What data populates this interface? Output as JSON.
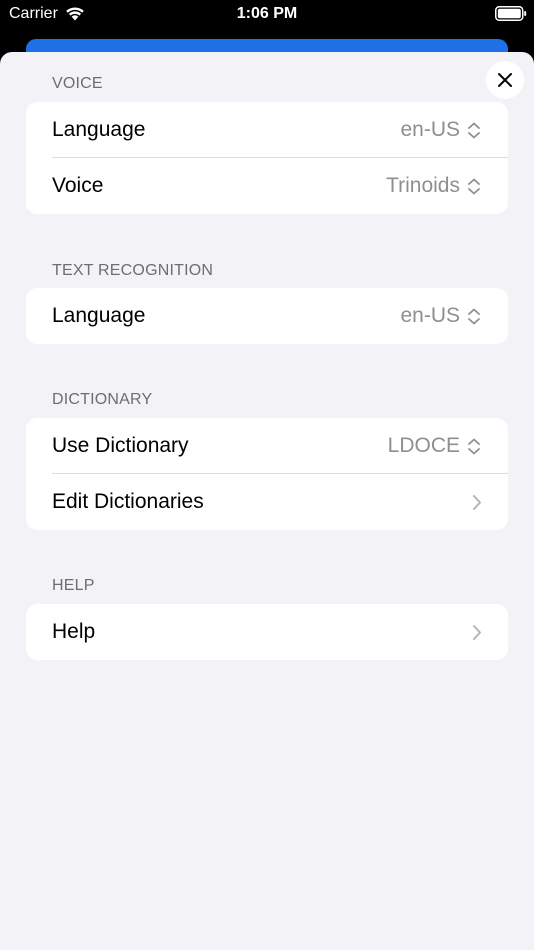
{
  "status_bar": {
    "carrier": "Carrier",
    "time": "1:06 PM"
  },
  "sections": {
    "voice": {
      "header": "VOICE",
      "language_label": "Language",
      "language_value": "en-US",
      "voice_label": "Voice",
      "voice_value": "Trinoids"
    },
    "text_recognition": {
      "header": "TEXT RECOGNITION",
      "language_label": "Language",
      "language_value": "en-US"
    },
    "dictionary": {
      "header": "DICTIONARY",
      "use_label": "Use Dictionary",
      "use_value": "LDOCE",
      "edit_label": "Edit Dictionaries"
    },
    "help": {
      "header": "HELP",
      "help_label": "Help"
    }
  },
  "icons": {
    "close": "close-icon",
    "updown": "chevron-up-down-icon",
    "chevron": "chevron-right-icon",
    "wifi": "wifi-icon",
    "battery": "battery-icon"
  },
  "colors": {
    "background": "#f2f2f7",
    "card": "#ffffff",
    "accent_behind": "#1f6fe6",
    "secondary_text": "#8e8e93",
    "header_text": "#6d6d72"
  }
}
